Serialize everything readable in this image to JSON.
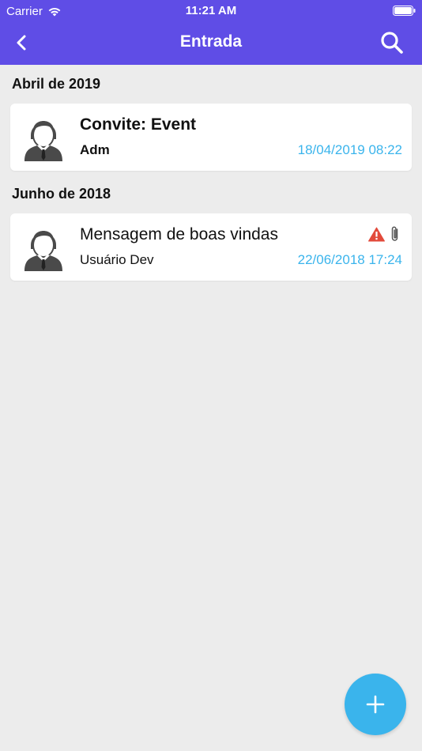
{
  "status_bar": {
    "carrier": "Carrier",
    "time": "11:21 AM"
  },
  "nav": {
    "title": "Entrada",
    "back_icon": "chevron-left-icon",
    "search_icon": "search-icon"
  },
  "sections": [
    {
      "title": "Abril de 2019",
      "messages": [
        {
          "subject": "Convite: Event",
          "sender": "Adm",
          "date": "18/04/2019 08:22",
          "unread": true,
          "has_warning": false,
          "has_attachment": false
        }
      ]
    },
    {
      "title": "Junho de 2018",
      "messages": [
        {
          "subject": "Mensagem de boas vindas",
          "sender": "Usuário Dev",
          "date": "22/06/2018 17:24",
          "unread": false,
          "has_warning": true,
          "has_attachment": true
        }
      ]
    }
  ],
  "fab": {
    "icon": "plus-icon"
  },
  "colors": {
    "header": "#5f4de6",
    "background": "#ececec",
    "date": "#3ab4ec",
    "fab": "#3ab4ec",
    "warning": "#e24a3b",
    "avatar": "#4a4a4a"
  }
}
